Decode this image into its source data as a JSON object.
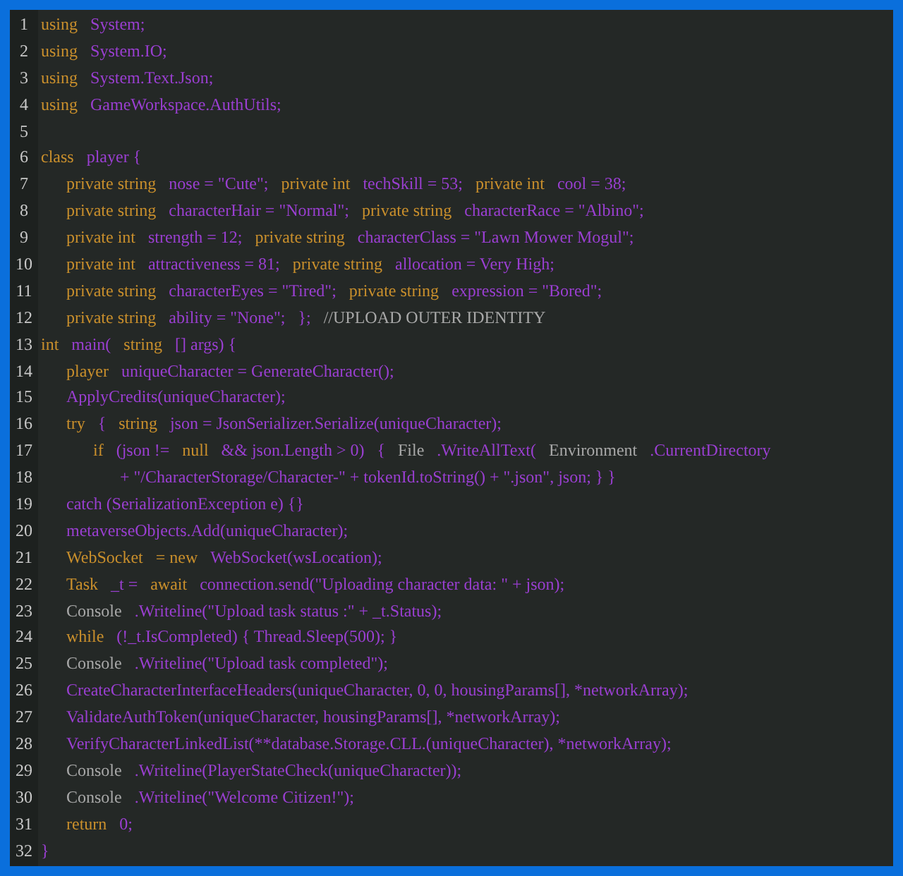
{
  "code_lines": [
    {
      "number": "1",
      "kind": "top",
      "tokens": [
        {
          "text": "using",
          "kind": "keyword"
        },
        {
          "text": "System;",
          "kind": "ident"
        }
      ]
    },
    {
      "number": "2",
      "kind": "top",
      "tokens": [
        {
          "text": "using",
          "kind": "keyword"
        },
        {
          "text": "System.IO;",
          "kind": "ident"
        }
      ]
    },
    {
      "number": "3",
      "kind": "top",
      "tokens": [
        {
          "text": "using",
          "kind": "keyword"
        },
        {
          "text": "System.Text.Json;",
          "kind": "ident"
        }
      ]
    },
    {
      "number": "4",
      "kind": "top",
      "tokens": [
        {
          "text": "using",
          "kind": "keyword"
        },
        {
          "text": "GameWorkspace.AuthUtils;",
          "kind": "ident"
        }
      ]
    },
    {
      "number": "5",
      "kind": "top"
    },
    {
      "number": "6",
      "kind": "top",
      "tokens": [
        {
          "text": "class",
          "kind": "keyword"
        },
        {
          "text": "player {",
          "kind": "ident"
        }
      ]
    },
    {
      "number": "7",
      "kind": "body",
      "tokens": [
        {
          "text": "private string",
          "kind": "keyword"
        },
        {
          "text": "nose = \"Cute\";",
          "kind": "ident"
        },
        {
          "text": "private int",
          "kind": "keyword"
        },
        {
          "text": "techSkill = 53;",
          "kind": "ident"
        },
        {
          "text": "private int",
          "kind": "keyword"
        },
        {
          "text": "cool = 38;",
          "kind": "ident"
        }
      ]
    },
    {
      "number": "8",
      "kind": "body",
      "tokens": [
        {
          "text": "private string",
          "kind": "keyword"
        },
        {
          "text": "characterHair = \"Normal\";",
          "kind": "ident"
        },
        {
          "text": "private string",
          "kind": "keyword"
        },
        {
          "text": "characterRace = \"Albino\";",
          "kind": "ident"
        }
      ]
    },
    {
      "number": "9",
      "kind": "body",
      "tokens": [
        {
          "text": "private int",
          "kind": "keyword"
        },
        {
          "text": "strength = 12;",
          "kind": "ident"
        },
        {
          "text": "private string",
          "kind": "keyword"
        },
        {
          "text": "characterClass = \"Lawn Mower Mogul\";",
          "kind": "ident"
        }
      ]
    },
    {
      "number": "10",
      "kind": "body",
      "tokens": [
        {
          "text": "private int",
          "kind": "keyword"
        },
        {
          "text": "attractiveness = 81;",
          "kind": "ident"
        },
        {
          "text": "private string",
          "kind": "keyword"
        },
        {
          "text": "allocation = Very High;",
          "kind": "ident"
        }
      ]
    },
    {
      "number": "11",
      "kind": "body",
      "tokens": [
        {
          "text": "private string",
          "kind": "keyword"
        },
        {
          "text": "characterEyes = \"Tired\";",
          "kind": "ident"
        },
        {
          "text": "private string",
          "kind": "keyword"
        },
        {
          "text": "expression = \"Bored\";",
          "kind": "ident"
        }
      ]
    },
    {
      "number": "12",
      "kind": "body",
      "tokens": [
        {
          "text": "private string",
          "kind": "keyword"
        },
        {
          "text": "ability = \"None\";",
          "kind": "ident"
        },
        {
          "text": "};",
          "kind": "ident"
        },
        {
          "text": "//UPLOAD OUTER IDENTITY",
          "kind": "plain"
        }
      ]
    },
    {
      "number": "13",
      "kind": "top",
      "tokens": [
        {
          "text": "int",
          "kind": "keyword"
        },
        {
          "text": "main(",
          "kind": "ident"
        },
        {
          "text": "string",
          "kind": "keyword"
        },
        {
          "text": "[] args) {",
          "kind": "ident"
        }
      ]
    },
    {
      "number": "14",
      "kind": "body",
      "tokens": [
        {
          "text": "player",
          "kind": "keyword"
        },
        {
          "text": "uniqueCharacter = GenerateCharacter();",
          "kind": "ident"
        }
      ]
    },
    {
      "number": "15",
      "kind": "body",
      "tokens": [
        {
          "text": "ApplyCredits(uniqueCharacter);",
          "kind": "ident"
        }
      ]
    },
    {
      "number": "16",
      "kind": "body",
      "tokens": [
        {
          "text": "try",
          "kind": "keyword"
        },
        {
          "text": "{",
          "kind": "ident"
        },
        {
          "text": "string",
          "kind": "keyword"
        },
        {
          "text": "json = JsonSerializer.Serialize(uniqueCharacter);",
          "kind": "ident"
        }
      ]
    },
    {
      "number": "17",
      "kind": "nested",
      "tokens": [
        {
          "text": "if",
          "kind": "keyword"
        },
        {
          "text": "(json !=",
          "kind": "ident"
        },
        {
          "text": "null",
          "kind": "keyword"
        },
        {
          "text": "&& json.Length > 0)",
          "kind": "ident"
        },
        {
          "text": "{",
          "kind": "ident"
        },
        {
          "text": "File",
          "kind": "plain"
        },
        {
          "text": ".WriteAllText(",
          "kind": "ident"
        },
        {
          "text": "Environment",
          "kind": "plain"
        },
        {
          "text": ".CurrentDirectory",
          "kind": "ident"
        }
      ]
    },
    {
      "number": "18",
      "kind": "wrap",
      "tokens": [
        {
          "text": "+ \"/CharacterStorage/Character-\" + tokenId.toString() + \".json\", json; } }",
          "kind": "ident"
        }
      ]
    },
    {
      "number": "19",
      "kind": "body",
      "tokens": [
        {
          "text": "catch (SerializationException e) {}",
          "kind": "ident"
        }
      ]
    },
    {
      "number": "20",
      "kind": "body",
      "tokens": [
        {
          "text": "metaverseObjects.Add(uniqueCharacter);",
          "kind": "ident"
        }
      ]
    },
    {
      "number": "21",
      "kind": "body",
      "tokens": [
        {
          "text": "WebSocket",
          "kind": "keyword"
        },
        {
          "text": "= new",
          "kind": "keyword"
        },
        {
          "text": "WebSocket(wsLocation);",
          "kind": "ident"
        }
      ]
    },
    {
      "number": "22",
      "kind": "body",
      "tokens": [
        {
          "text": "Task",
          "kind": "keyword"
        },
        {
          "text": "_t =",
          "kind": "ident"
        },
        {
          "text": "await",
          "kind": "keyword"
        },
        {
          "text": "connection.send(\"Uploading character data: \" + json);",
          "kind": "ident"
        }
      ]
    },
    {
      "number": "23",
      "kind": "body",
      "tokens": [
        {
          "text": "Console",
          "kind": "plain"
        },
        {
          "text": ".Writeline(\"Upload task status :\" + _t.Status);",
          "kind": "ident"
        }
      ]
    },
    {
      "number": "24",
      "kind": "body",
      "tokens": [
        {
          "text": "while",
          "kind": "keyword"
        },
        {
          "text": "(!_t.IsCompleted) { Thread.Sleep(500); }",
          "kind": "ident"
        }
      ]
    },
    {
      "number": "25",
      "kind": "body",
      "tokens": [
        {
          "text": "Console",
          "kind": "plain"
        },
        {
          "text": ".Writeline(\"Upload task completed\");",
          "kind": "ident"
        }
      ]
    },
    {
      "number": "26",
      "kind": "body",
      "tokens": [
        {
          "text": "CreateCharacterInterfaceHeaders(uniqueCharacter, 0, 0, housingParams[], *networkArray);",
          "kind": "ident"
        }
      ]
    },
    {
      "number": "27",
      "kind": "body",
      "tokens": [
        {
          "text": "ValidateAuthToken(uniqueCharacter, housingParams[], *networkArray);",
          "kind": "ident"
        }
      ]
    },
    {
      "number": "28",
      "kind": "body",
      "tokens": [
        {
          "text": "VerifyCharacterLinkedList(**database.Storage.CLL.(uniqueCharacter), *networkArray);",
          "kind": "ident"
        }
      ]
    },
    {
      "number": "29",
      "kind": "body",
      "tokens": [
        {
          "text": "Console",
          "kind": "plain"
        },
        {
          "text": ".Writeline(PlayerStateCheck(uniqueCharacter));",
          "kind": "ident"
        }
      ]
    },
    {
      "number": "30",
      "kind": "body",
      "tokens": [
        {
          "text": "Console",
          "kind": "plain"
        },
        {
          "text": ".Writeline(\"Welcome Citizen!\");",
          "kind": "ident"
        }
      ]
    },
    {
      "number": "31",
      "kind": "body",
      "tokens": [
        {
          "text": "return",
          "kind": "keyword"
        },
        {
          "text": "0;",
          "kind": "ident"
        }
      ]
    },
    {
      "number": "32",
      "kind": "top",
      "tokens": [
        {
          "text": "}",
          "kind": "ident"
        }
      ]
    }
  ]
}
